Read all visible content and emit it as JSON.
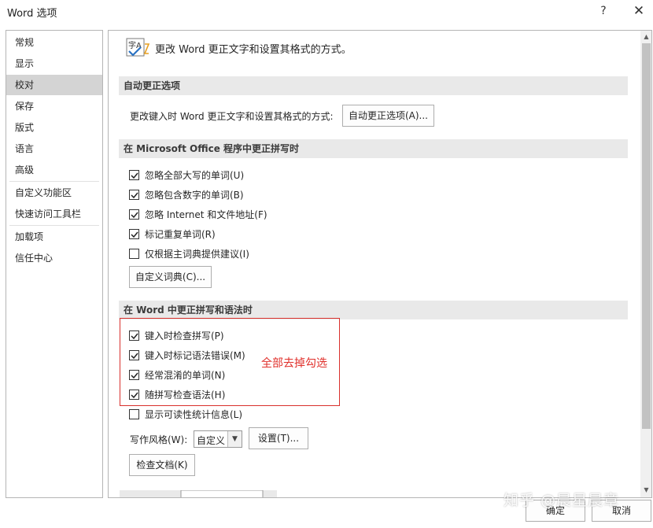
{
  "window": {
    "title": "Word 选项",
    "help_label": "?",
    "close_label": "✕"
  },
  "sidebar": {
    "items": [
      {
        "label": "常规"
      },
      {
        "label": "显示"
      },
      {
        "label": "校对",
        "selected": true
      },
      {
        "label": "保存"
      },
      {
        "label": "版式"
      },
      {
        "label": "语言"
      },
      {
        "label": "高级"
      },
      {
        "label": "自定义功能区"
      },
      {
        "label": "快速访问工具栏"
      },
      {
        "label": "加载项"
      },
      {
        "label": "信任中心"
      }
    ]
  },
  "header": {
    "icon": "spelling-grammar-icon",
    "text": "更改 Word 更正文字和设置其格式的方式。"
  },
  "autocorrect_section": {
    "title": "自动更正选项",
    "row_label": "更改键入时 Word 更正文字和设置其格式的方式:",
    "button_label": "自动更正选项(A)..."
  },
  "office_section": {
    "title": "在 Microsoft Office 程序中更正拼写时",
    "options": [
      {
        "label": "忽略全部大写的单词(U)",
        "checked": true
      },
      {
        "label": "忽略包含数字的单词(B)",
        "checked": true
      },
      {
        "label": "忽略 Internet 和文件地址(F)",
        "checked": true
      },
      {
        "label": "标记重复单词(R)",
        "checked": true
      },
      {
        "label": "仅根据主词典提供建议(I)",
        "checked": false
      }
    ],
    "dict_button_label": "自定义词典(C)..."
  },
  "word_section": {
    "title": "在 Word 中更正拼写和语法时",
    "options": [
      {
        "label": "键入时检查拼写(P)",
        "checked": true
      },
      {
        "label": "键入时标记语法错误(M)",
        "checked": true
      },
      {
        "label": "经常混淆的单词(N)",
        "checked": true
      },
      {
        "label": "随拼写检查语法(H)",
        "checked": true
      },
      {
        "label": "显示可读性统计信息(L)",
        "checked": false
      }
    ],
    "annotation": "全部去掉勾选",
    "writing_style_label": "写作风格(W):",
    "writing_style_value": "自定义",
    "settings_button_label": "设置(T)...",
    "check_doc_button_label": "检查文档(K)"
  },
  "footer": {
    "ok_label": "确定",
    "cancel_label": "取消"
  },
  "watermark": "知乎 @晨星晨章",
  "colors": {
    "annotation": "#e0302b",
    "selected_nav": "#d4d4d4",
    "section_bg": "#e9e9e9"
  }
}
